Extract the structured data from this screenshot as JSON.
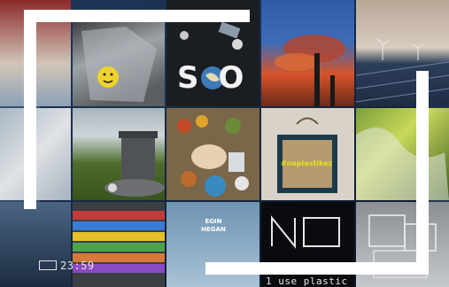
{
  "image_title": "",
  "tiles": [
    {
      "id": "plastic-bag-smiley",
      "text": ""
    },
    {
      "id": "sos-globe",
      "text": "SOS"
    },
    {
      "id": "smokestack-sunset",
      "text": ""
    },
    {
      "id": "wind-turbines",
      "text": ""
    },
    {
      "id": "garbage-bin",
      "text": ""
    },
    {
      "id": "food-waste",
      "text": ""
    },
    {
      "id": "tote-bag",
      "text": "#noplastikez"
    },
    {
      "id": "supermarket-aisle",
      "text": ""
    },
    {
      "id": "protest-sign",
      "text": "EGIN\nHEGAN"
    },
    {
      "id": "neon-no",
      "text": "NO"
    },
    {
      "id": "glass-boxes",
      "text": ""
    }
  ],
  "overlay": {
    "timestamp": "23:59",
    "caption": "1 use plastic"
  },
  "colors": {
    "frame": "#ffffff",
    "background": "#0e1a2c",
    "hashtag": "#e6e01c"
  }
}
